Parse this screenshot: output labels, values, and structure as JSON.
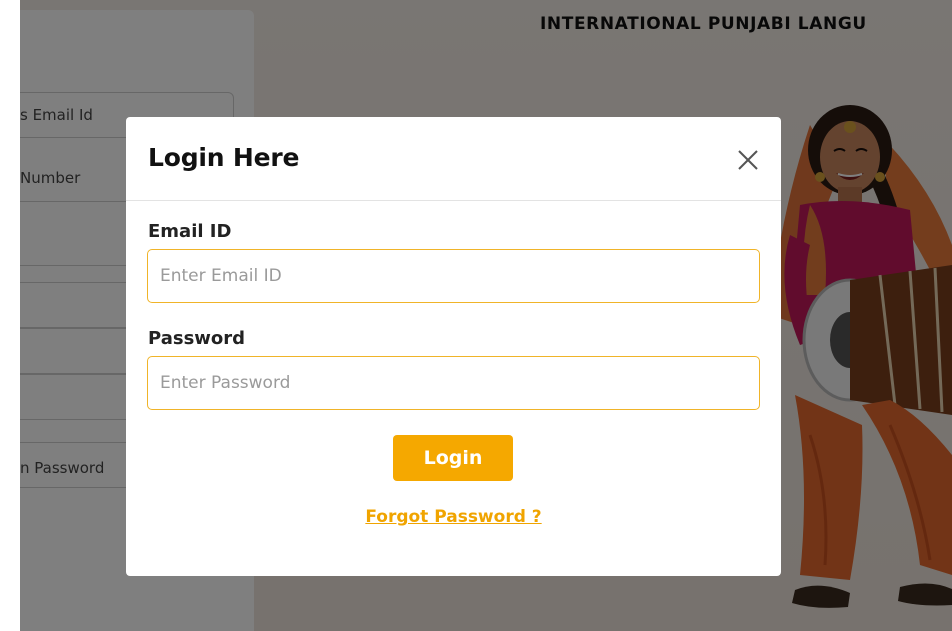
{
  "site": {
    "title": "INTERNATIONAL PUNJABI LANGU"
  },
  "registration": {
    "fields": [
      {
        "label": "s Email Id"
      },
      {
        "label": " Number"
      },
      {
        "label": ""
      },
      {
        "label": ""
      },
      {
        "label": ""
      },
      {
        "label": "n Password"
      }
    ]
  },
  "modal": {
    "title": "Login Here",
    "close_icon": "close-icon",
    "email": {
      "label": "Email ID",
      "placeholder": "Enter Email ID",
      "value": ""
    },
    "password": {
      "label": "Password",
      "placeholder": "Enter Password",
      "value": ""
    },
    "login_label": "Login",
    "forgot_label": "Forgot Password ?"
  },
  "colors": {
    "accent": "#f5a800",
    "input_border": "#f0b429",
    "overlay": "rgba(0,0,0,0.5)"
  }
}
